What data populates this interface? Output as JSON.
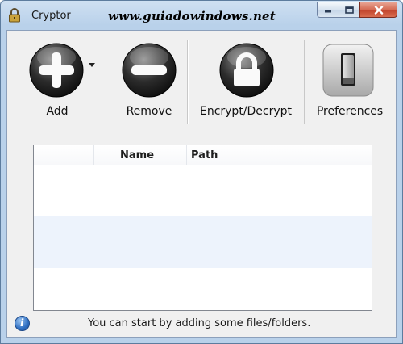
{
  "window": {
    "title": "Cryptor",
    "watermark": "www.guiadowindows.net"
  },
  "toolbar": {
    "add_label": "Add",
    "remove_label": "Remove",
    "encrypt_label": "Encrypt/Decrypt",
    "preferences_label": "Preferences"
  },
  "list": {
    "columns": [
      "",
      "Name",
      "Path"
    ],
    "rows": []
  },
  "status": {
    "message": "You can start by adding some files/folders."
  },
  "colors": {
    "titlebar": "#b9d1ea",
    "row_alt": "#edf3fc",
    "close_button": "#c0412a"
  },
  "icons": [
    "lock-icon",
    "add-icon",
    "remove-icon",
    "padlock-icon",
    "toggle-switch-icon",
    "info-icon",
    "dropdown-arrow-icon"
  ]
}
